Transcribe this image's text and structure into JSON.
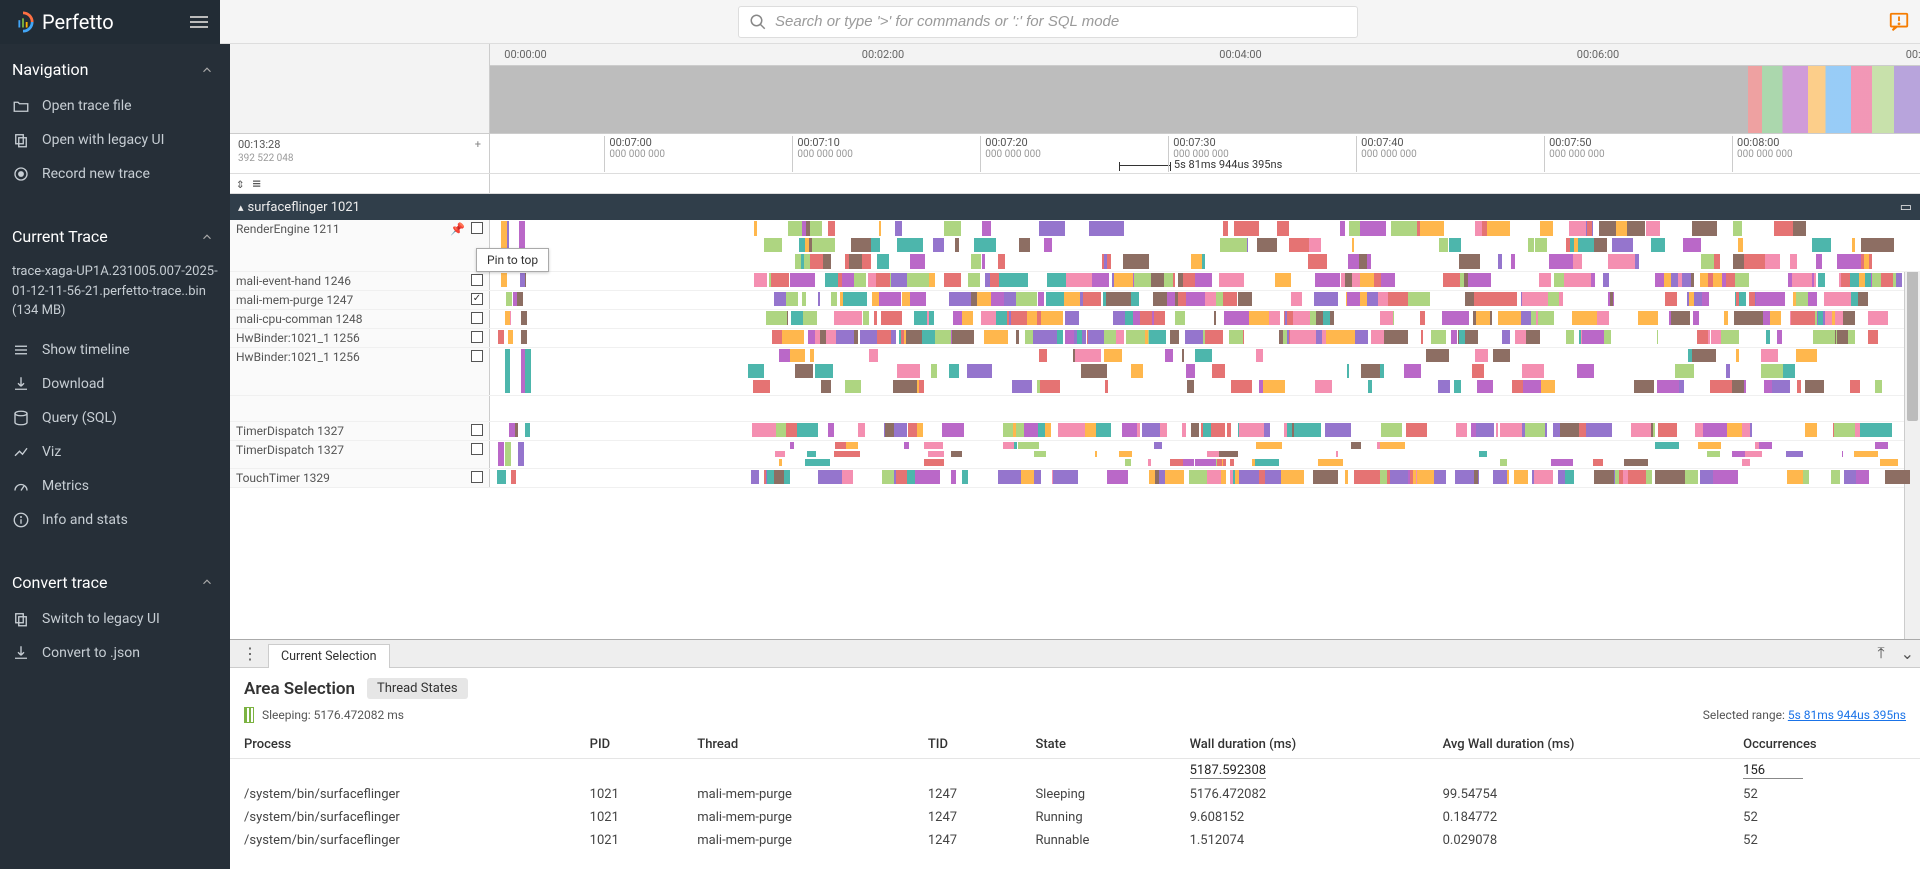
{
  "brand": "Perfetto",
  "search": {
    "placeholder": "Search or type '>' for commands or ':' for SQL mode"
  },
  "sidebar": {
    "sections": {
      "navigation": {
        "title": "Navigation"
      },
      "current_trace": {
        "title": "Current Trace"
      },
      "convert": {
        "title": "Convert trace"
      }
    },
    "nav_items": [
      {
        "label": "Open trace file"
      },
      {
        "label": "Open with legacy UI"
      },
      {
        "label": "Record new trace"
      }
    ],
    "trace_file": "trace-xaga-UP1A.231005.007-2025-01-12-11-56-21.perfetto-trace..bin (134 MB)",
    "trace_items": [
      {
        "label": "Show timeline"
      },
      {
        "label": "Download"
      },
      {
        "label": "Query (SQL)"
      },
      {
        "label": "Viz"
      },
      {
        "label": "Metrics"
      },
      {
        "label": "Info and stats"
      }
    ],
    "convert_items": [
      {
        "label": "Switch to legacy UI"
      },
      {
        "label": "Convert to .json"
      }
    ]
  },
  "overview": {
    "ticks": [
      "00:00:00",
      "00:02:00",
      "00:04:00",
      "00:06:00",
      "00:"
    ]
  },
  "ruler": {
    "left_top": "00:13:28",
    "left_bottom": "392 522 048",
    "ticks": [
      {
        "t": "00:07:00",
        "s": "000 000 000"
      },
      {
        "t": "00:07:10",
        "s": "000 000 000"
      },
      {
        "t": "00:07:20",
        "s": "000 000 000"
      },
      {
        "t": "00:07:30",
        "s": "000 000 000"
      },
      {
        "t": "00:07:40",
        "s": "000 000 000"
      },
      {
        "t": "00:07:50",
        "s": "000 000 000"
      },
      {
        "t": "00:08:00",
        "s": "000 000 000"
      },
      {
        "t": "00:",
        "s": ""
      }
    ],
    "range_label": "5s 81ms 944us 395ns"
  },
  "process_header": "surfaceflinger 1021",
  "tooltip": "Pin to top",
  "tracks": [
    {
      "name": "RenderEngine 1211",
      "pin": true,
      "checked": false,
      "style": "tall"
    },
    {
      "name": "mali-event-hand 1246",
      "checked": false,
      "style": ""
    },
    {
      "name": "mali-mem-purge 1247",
      "checked": true,
      "style": ""
    },
    {
      "name": "mali-cpu-comman 1248",
      "checked": false,
      "style": ""
    },
    {
      "name": "HwBinder:1021_1 1256",
      "checked": false,
      "style": ""
    },
    {
      "name": "HwBinder:1021_1 1256",
      "checked": false,
      "style": "big"
    },
    {
      "name": "TimerDispatch 1327",
      "checked": false,
      "style": ""
    },
    {
      "name": "TimerDispatch 1327",
      "checked": false,
      "style": "mid"
    },
    {
      "name": "TouchTimer 1329",
      "checked": false,
      "style": ""
    }
  ],
  "details": {
    "tab": "Current Selection",
    "title": "Area Selection",
    "tag": "Thread States",
    "sleeping_label": "Sleeping: 5176.472082 ms",
    "range_prefix": "Selected range:",
    "range_value": "5s 81ms 944us 395ns",
    "columns": [
      "Process",
      "PID",
      "Thread",
      "TID",
      "State",
      "Wall duration (ms)",
      "Avg Wall duration (ms)",
      "Occurrences"
    ],
    "summary": {
      "wall": "5187.592308",
      "occ": "156"
    },
    "rows": [
      {
        "process": "/system/bin/surfaceflinger",
        "pid": "1021",
        "thread": "mali-mem-purge",
        "tid": "1247",
        "state": "Sleeping",
        "wall": "5176.472082",
        "avg": "99.54754",
        "occ": "52"
      },
      {
        "process": "/system/bin/surfaceflinger",
        "pid": "1021",
        "thread": "mali-mem-purge",
        "tid": "1247",
        "state": "Running",
        "wall": "9.608152",
        "avg": "0.184772",
        "occ": "52"
      },
      {
        "process": "/system/bin/surfaceflinger",
        "pid": "1021",
        "thread": "mali-mem-purge",
        "tid": "1247",
        "state": "Runnable",
        "wall": "1.512074",
        "avg": "0.029078",
        "occ": "52"
      }
    ]
  }
}
